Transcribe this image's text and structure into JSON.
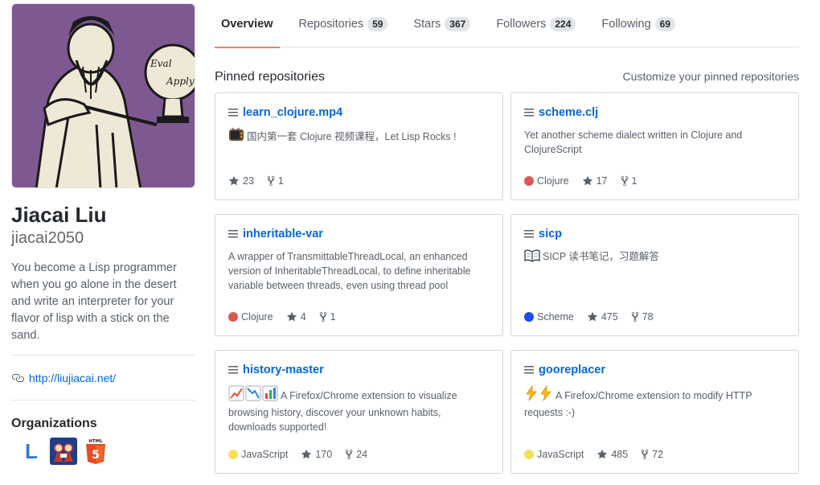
{
  "profile": {
    "name": "Jiacai Liu",
    "login": "jiacai2050",
    "bio": "You become a Lisp programmer when you go alone in the desert and write an interpreter for your flavor of lisp with a stick on the sand.",
    "website": "http://liujiacai.net/",
    "avatar_text_top": "Eval",
    "avatar_text_bottom": "Apply",
    "orgs_title": "Organizations"
  },
  "tabs": [
    {
      "label": "Overview",
      "count": "",
      "selected": true
    },
    {
      "label": "Repositories",
      "count": "59"
    },
    {
      "label": "Stars",
      "count": "367"
    },
    {
      "label": "Followers",
      "count": "224"
    },
    {
      "label": "Following",
      "count": "69"
    }
  ],
  "pinned": {
    "title": "Pinned repositories",
    "customize": "Customize your pinned repositories",
    "repos": [
      {
        "name": "learn_clojure.mp4",
        "description": "国内第一套 Clojure 视频课程，Let Lisp Rocks !",
        "language": "",
        "lang_color": "",
        "stars": "23",
        "forks": "1"
      },
      {
        "name": "scheme.clj",
        "description": "Yet another scheme dialect written in Clojure and ClojureScript",
        "language": "Clojure",
        "lang_color": "#db5855",
        "stars": "17",
        "forks": "1"
      },
      {
        "name": "inheritable-var",
        "description": "A wrapper of TransmittableThreadLocal, an enhanced version of InheritableThreadLocal, to define inheritable variable between threads, even using thread pool",
        "language": "Clojure",
        "lang_color": "#db5855",
        "stars": "4",
        "forks": "1"
      },
      {
        "name": "sicp",
        "description": "SICP 读书笔记，习题解答",
        "language": "Scheme",
        "lang_color": "#1e4aec",
        "stars": "475",
        "forks": "78"
      },
      {
        "name": "history-master",
        "description": "A Firefox/Chrome extension to visualize browsing history, discover your unknown habits, downloads supported!",
        "language": "JavaScript",
        "lang_color": "#f1e05a",
        "stars": "170",
        "forks": "24"
      },
      {
        "name": "gooreplacer",
        "description": "A Firefox/Chrome extension to modify HTTP requests :-)",
        "language": "JavaScript",
        "lang_color": "#f1e05a",
        "stars": "485",
        "forks": "72"
      }
    ]
  },
  "orgs": [
    {
      "label": "L",
      "icon": "letter-l-org-icon"
    },
    {
      "label": "",
      "icon": "sicp-org-icon"
    },
    {
      "label": "HTML 5",
      "icon": "html5-org-icon"
    }
  ],
  "colors": {
    "link": "#0366d6",
    "tab_underline": "#f9826c",
    "clojure": "#db5855",
    "scheme": "#1e4aec",
    "javascript": "#f1e05a"
  }
}
